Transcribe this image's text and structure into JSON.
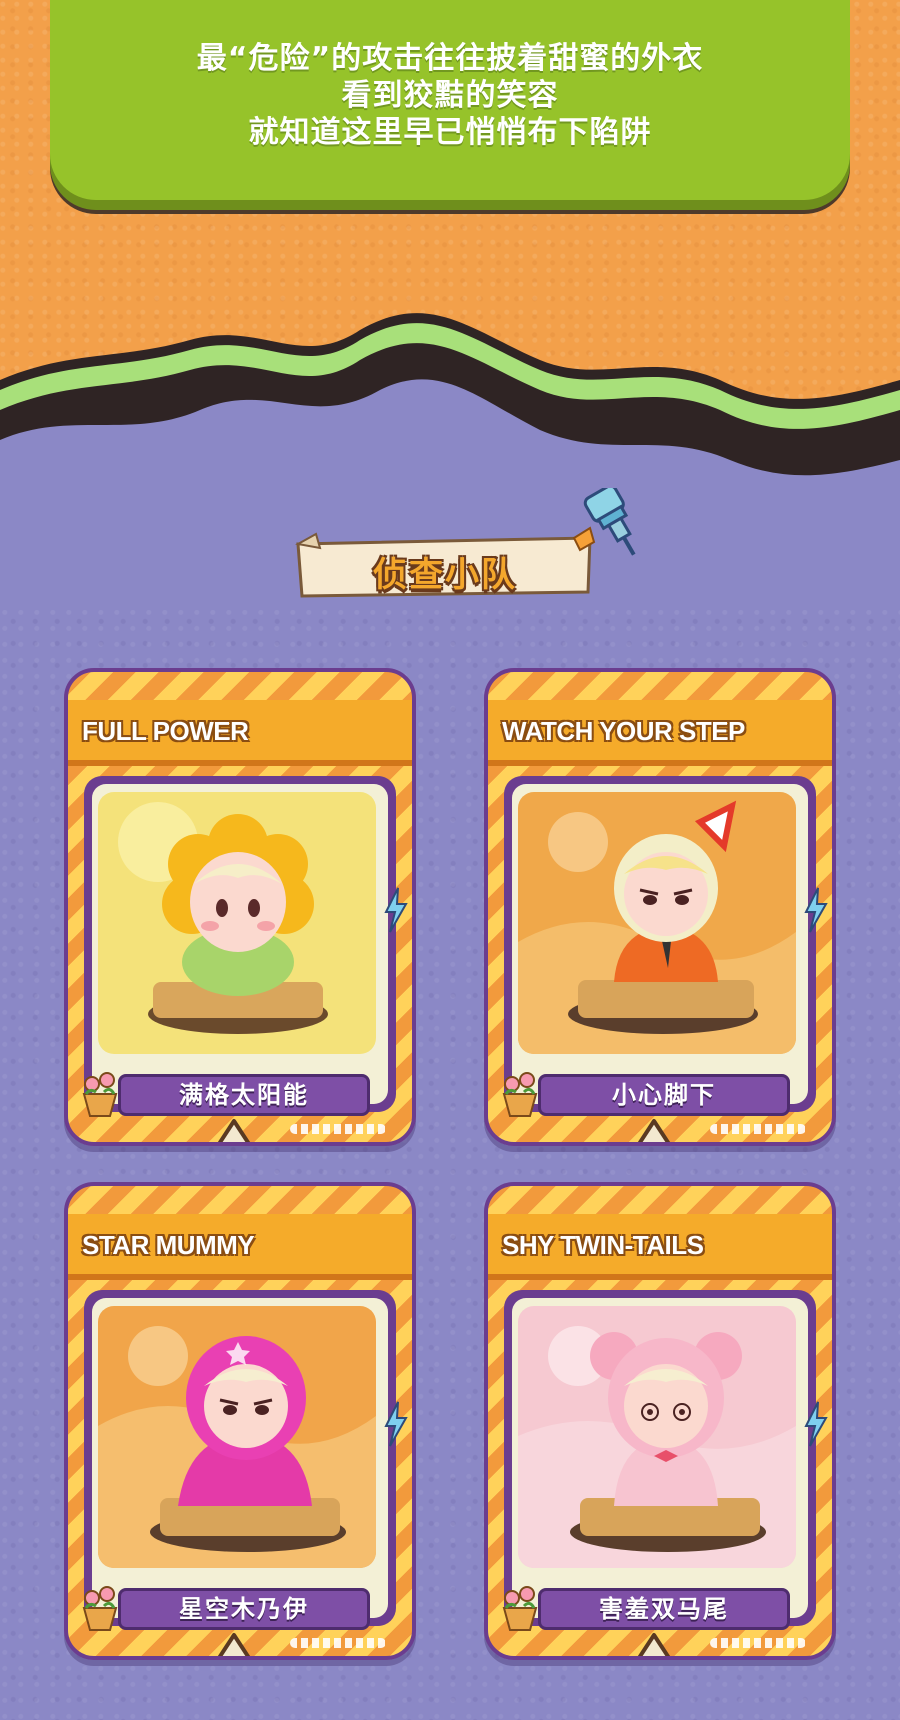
{
  "banner": {
    "lines": [
      "最“危险”的攻击往往披着甜蜜的外衣",
      "看到狡黠的笑容",
      "就知道这里早已悄悄布下陷阱"
    ]
  },
  "section": {
    "title": "侦查小队",
    "pin_icon": "pushpin-icon"
  },
  "colors": {
    "orange_bg": "#f3a04a",
    "purple_bg": "#8b88c6",
    "green_banner": "#96c32a",
    "card_header": "#f5ab2a",
    "card_border": "#6b3d8f"
  },
  "cards": [
    {
      "en_title": "FULL POWER",
      "cn_name": "满格太阳能",
      "icons": [
        "lightning-icon",
        "flower-pot-icon",
        "triangle-icon"
      ]
    },
    {
      "en_title": "WATCH YOUR STEP",
      "cn_name": "小心脚下",
      "icons": [
        "lightning-icon",
        "flower-pot-icon",
        "triangle-icon"
      ]
    },
    {
      "en_title": "STAR MUMMY",
      "cn_name": "星空木乃伊",
      "icons": [
        "lightning-icon",
        "flower-pot-icon",
        "triangle-icon"
      ]
    },
    {
      "en_title": "SHY TWIN-TAILS",
      "cn_name": "害羞双马尾",
      "icons": [
        "lightning-icon",
        "flower-pot-icon",
        "triangle-icon"
      ]
    }
  ]
}
